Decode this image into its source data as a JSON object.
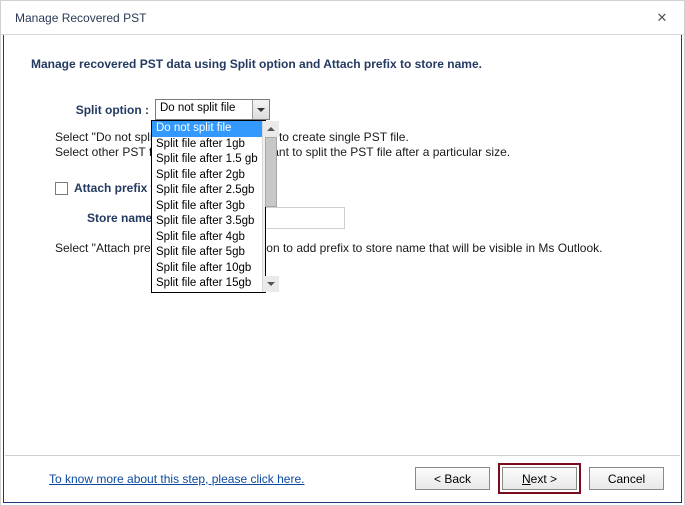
{
  "titlebar": {
    "title": "Manage Recovered PST"
  },
  "heading": "Manage recovered PST data using Split option and Attach prefix to store name.",
  "split": {
    "label": "Split option :",
    "selected": "Do not split file",
    "options": [
      "Do not split file",
      "Split file after 1gb",
      "Split file after 1.5 gb",
      "Split file after 2gb",
      "Split file after 2.5gb",
      "Split file after 3gb",
      "Split file after 3.5gb",
      "Split file after 4gb",
      "Split file after 5gb",
      "Split file after 10gb",
      "Split file after 15gb"
    ]
  },
  "hints": {
    "line1": "Select \"Do not split file\" option if you want to create single PST file.",
    "line2": "Select other PST file size option, if you want to split the PST file after a particular size.",
    "attach": "Select \"Attach prefix to store name\" option to add prefix to store name that will be visible in Ms Outlook."
  },
  "attach": {
    "checkbox_label": "Attach prefix to store name",
    "store_label": "Store name :",
    "store_value": ""
  },
  "footer": {
    "learn": "To know more about this step, please click here.",
    "back": "< Back",
    "next_prefix": "N",
    "next_rest": "ext >",
    "cancel": "Cancel"
  }
}
